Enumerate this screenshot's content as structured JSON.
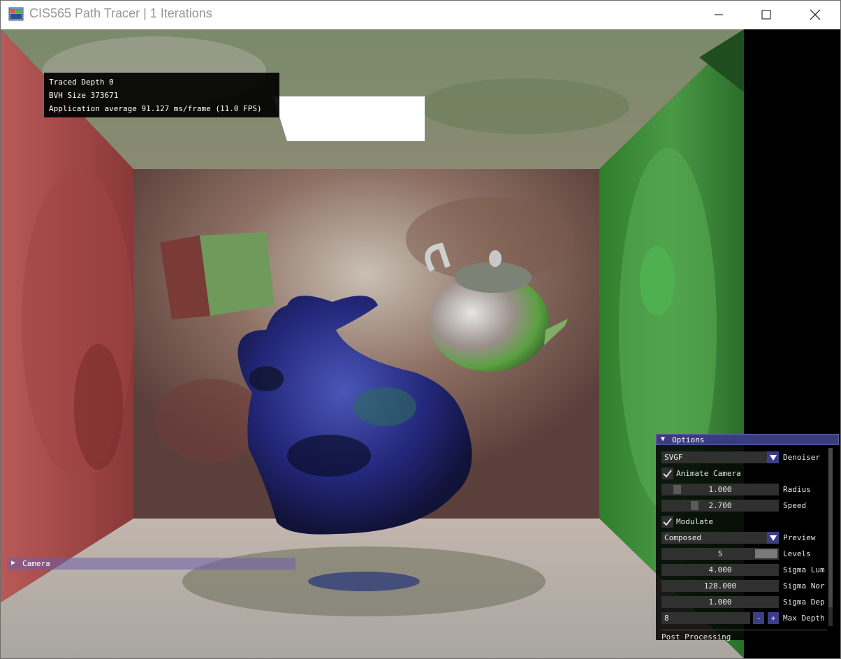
{
  "window": {
    "title": "CIS565 Path Tracer | 1 Iterations",
    "controls": [
      "minimize",
      "maximize",
      "close"
    ]
  },
  "stats": {
    "traced_depth": "Traced Depth 0",
    "bvh_size": "BVH Size 373671",
    "average": "Application average 91.127 ms/frame (11.0 FPS)"
  },
  "camera_header": {
    "label": "Camera",
    "arrow_icon": "triangle-right-icon"
  },
  "options": {
    "header": "Options",
    "denoiser": {
      "value": "SVGF",
      "label": "Denoiser"
    },
    "animate_camera": {
      "label": "Animate Camera",
      "checked": true
    },
    "radius": {
      "value": "1.000",
      "label": "Radius",
      "fill": 0.1
    },
    "speed": {
      "value": "2.700",
      "label": "Speed",
      "fill": 0.27
    },
    "modulate": {
      "label": "Modulate",
      "checked": true
    },
    "preview": {
      "value": "Composed",
      "label": "Preview"
    },
    "levels": {
      "value": "5",
      "label": "Levels",
      "fill": 1.0
    },
    "sigma_lum": {
      "value": "4.000",
      "label": "Sigma Lum"
    },
    "sigma_nor": {
      "value": "128.000",
      "label": "Sigma Nor"
    },
    "sigma_dep": {
      "value": "1.000",
      "label": "Sigma Dep"
    },
    "max_depth": {
      "value": "8",
      "label": "Max Depth",
      "minus": "-",
      "plus": "+"
    },
    "post_processing": "Post Processing"
  },
  "colors": {
    "imgui_header": "#3a3c80",
    "imgui_button": "#3b3e86",
    "imgui_frame": "#303030",
    "title_text": "#969696"
  }
}
